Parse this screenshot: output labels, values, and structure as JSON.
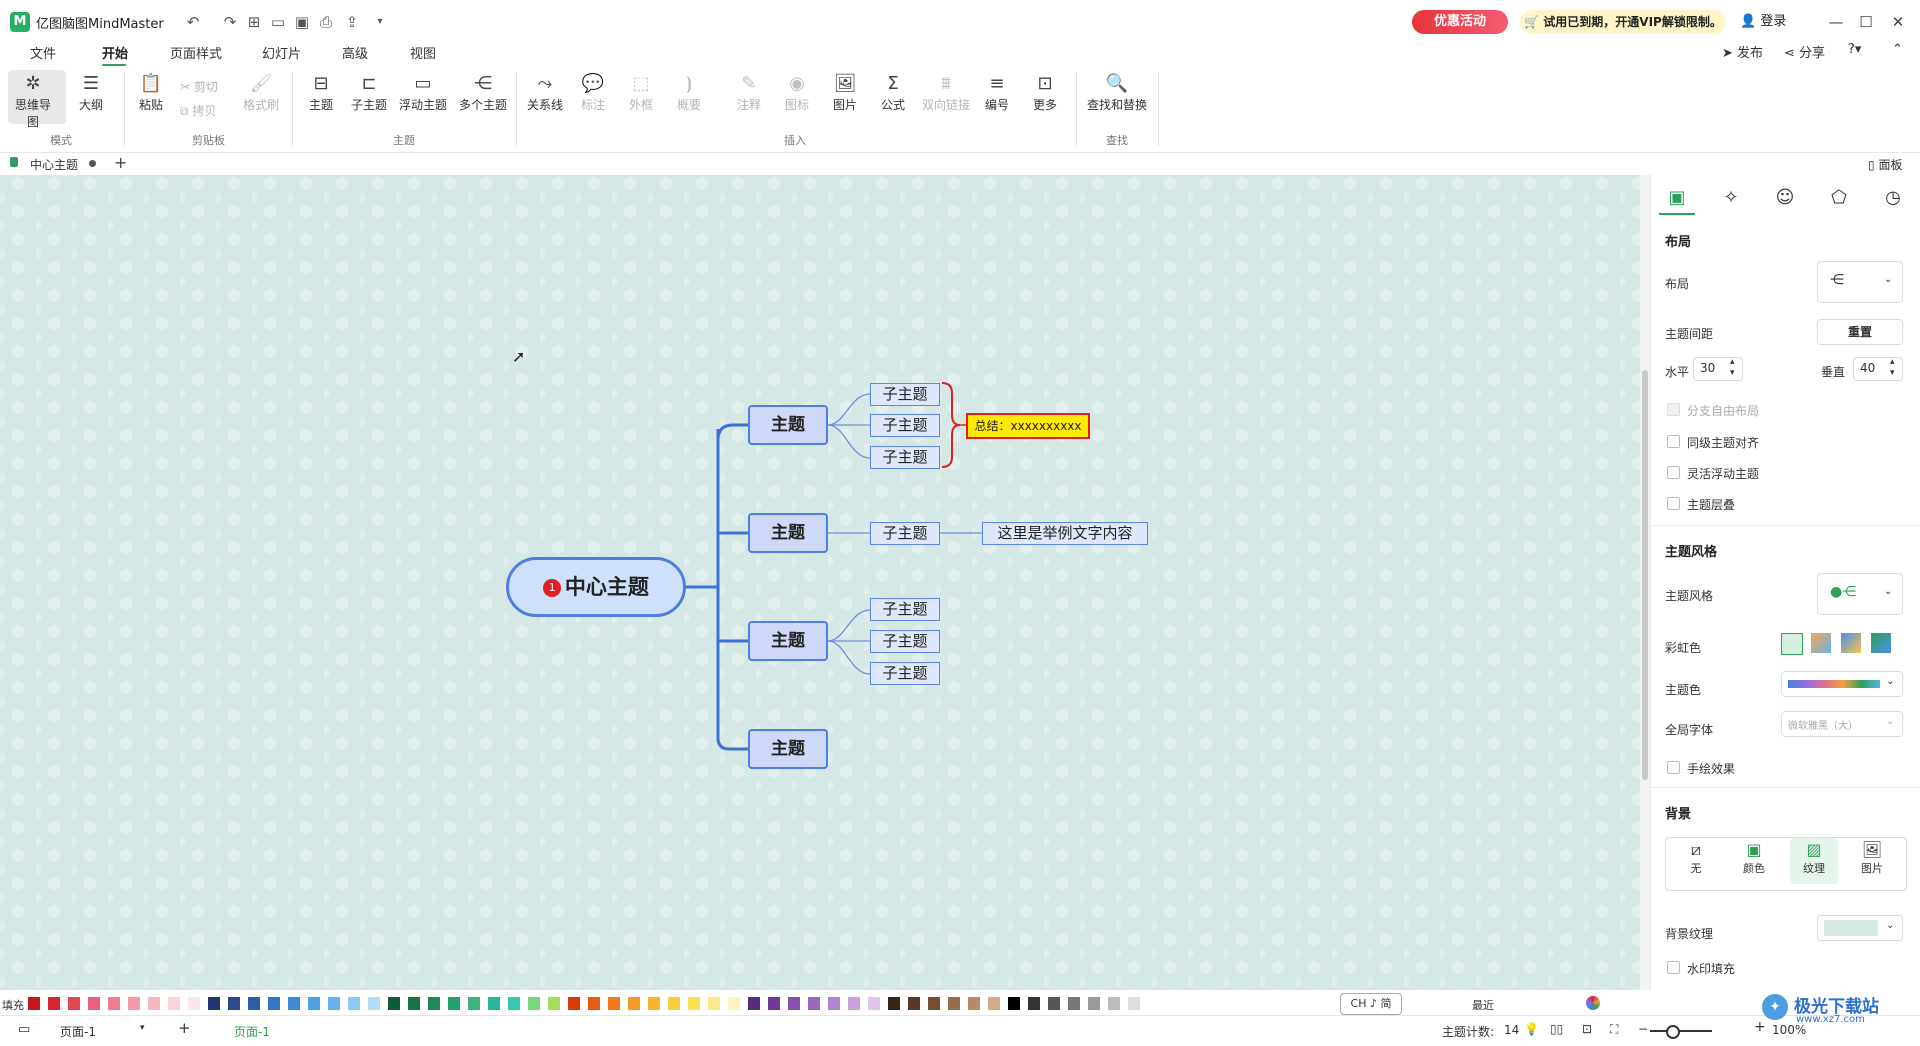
{
  "app": {
    "title": "亿图脑图MindMaster"
  },
  "header": {
    "promo": "优惠活动",
    "vip": "🛒 试用已到期，开通VIP解锁限制。",
    "login": "登录"
  },
  "menu": {
    "items": [
      "文件",
      "开始",
      "页面样式",
      "幻灯片",
      "高级",
      "视图"
    ],
    "publish": "发布",
    "share": "分享"
  },
  "ribbon": {
    "mode": {
      "mindmap": "思维导图",
      "outline": "大纲",
      "group": "模式"
    },
    "clipboard": {
      "paste": "粘贴",
      "cut": "剪切",
      "copy": "拷贝",
      "format": "格式刷",
      "group": "剪贴板"
    },
    "topic": {
      "topic": "主题",
      "subtopic": "子主题",
      "floating": "浮动主题",
      "multi": "多个主题",
      "group": "主题"
    },
    "insert": {
      "relation": "关系线",
      "label": "标注",
      "boundary": "外框",
      "summary": "概要",
      "note": "注释",
      "icon": "图标",
      "image": "图片",
      "formula": "公式",
      "link": "双向链接",
      "number": "编号",
      "more": "更多",
      "group": "插入"
    },
    "find": {
      "find": "查找和替换",
      "group": "查找"
    }
  },
  "tabs": {
    "doc": "中心主题",
    "panel": "面板"
  },
  "mindmap": {
    "central": "中心主题",
    "central_badge": "1",
    "topics": [
      "主题",
      "主题",
      "主题",
      "主题"
    ],
    "subtopic": "子主题",
    "summary": "总结：xxxxxxxxxx",
    "example_text": "这里是举例文字内容"
  },
  "panel": {
    "layout_title": "布局",
    "layout_label": "布局",
    "spacing_label": "主题间距",
    "reset": "重置",
    "horizontal_label": "水平",
    "horizontal_value": "30",
    "vertical_label": "垂直",
    "vertical_value": "40",
    "free_layout": "分支自由布局",
    "align_same": "同级主题对齐",
    "flexible_float": "灵活浮动主题",
    "overlap": "主题层叠",
    "style_title": "主题风格",
    "style_label": "主题风格",
    "rainbow": "彩虹色",
    "theme_color": "主题色",
    "global_font": "全局字体",
    "font_value": "微软雅黑（大）",
    "hand_drawn": "手绘效果",
    "bg_title": "背景",
    "bg_none": "无",
    "bg_color": "颜色",
    "bg_texture": "纹理",
    "bg_image": "图片",
    "bg_texture_label": "背景纹理",
    "watermark": "水印填充"
  },
  "palette": {
    "fill_label": "填充",
    "recent_label": "最近",
    "ime": "CH ♪ 简"
  },
  "status": {
    "page": "页面-1",
    "page_tab": "页面-1",
    "topic_count_label": "主题计数:",
    "topic_count": "14",
    "zoom": "100%"
  },
  "watermark": {
    "text": "极光下载站",
    "url": "www.xz7.com"
  },
  "colors": {
    "accent": "#2fa05a",
    "topic_border": "#4d7ee0",
    "summary_bracket": "#e02020",
    "summary_fill": "#ffea00",
    "canvas": "#d6e8e6"
  }
}
